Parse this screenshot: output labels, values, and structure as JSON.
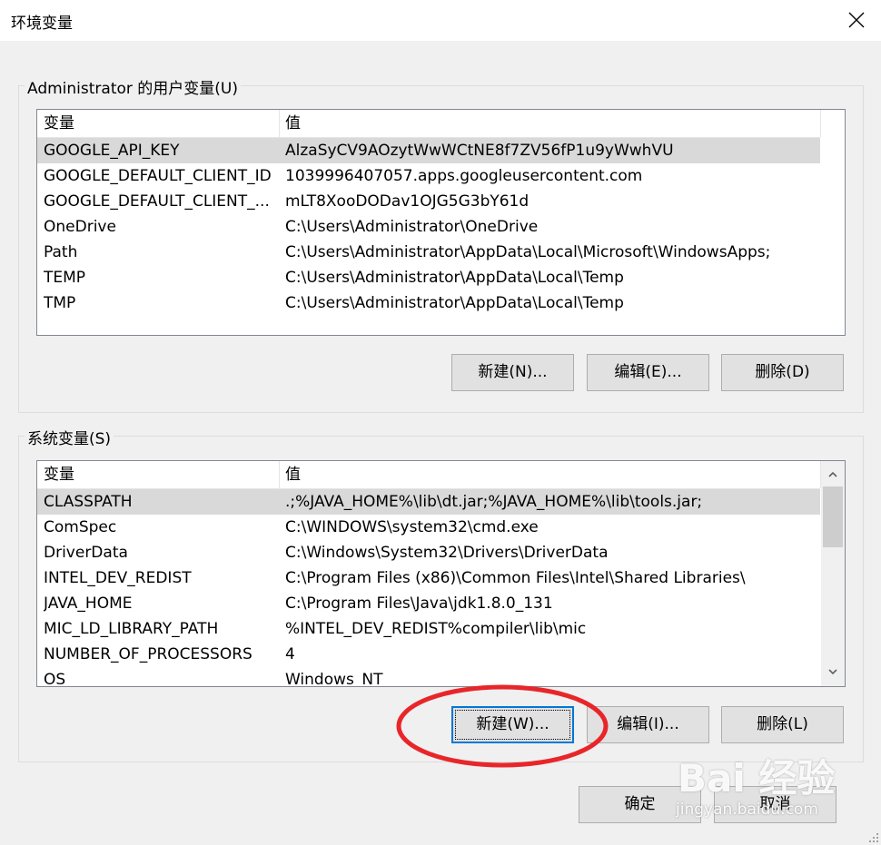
{
  "window": {
    "title": "环境变量"
  },
  "user_vars": {
    "legend": "Administrator 的用户变量(U)",
    "col_name": "变量",
    "col_value": "值",
    "rows": [
      {
        "name": "GOOGLE_API_KEY",
        "value": "AlzaSyCV9AOzytWwWCtNE8f7ZV56fP1u9yWwhVU",
        "selected": true
      },
      {
        "name": "GOOGLE_DEFAULT_CLIENT_ID",
        "value": "1039996407057.apps.googleusercontent.com"
      },
      {
        "name": "GOOGLE_DEFAULT_CLIENT_...",
        "value": "mLT8XooDODav1OJG5G3bY61d"
      },
      {
        "name": "OneDrive",
        "value": "C:\\Users\\Administrator\\OneDrive"
      },
      {
        "name": "Path",
        "value": "C:\\Users\\Administrator\\AppData\\Local\\Microsoft\\WindowsApps;"
      },
      {
        "name": "TEMP",
        "value": "C:\\Users\\Administrator\\AppData\\Local\\Temp"
      },
      {
        "name": "TMP",
        "value": "C:\\Users\\Administrator\\AppData\\Local\\Temp"
      }
    ],
    "buttons": {
      "new": "新建(N)...",
      "edit": "编辑(E)...",
      "delete": "删除(D)"
    }
  },
  "system_vars": {
    "legend": "系统变量(S)",
    "col_name": "变量",
    "col_value": "值",
    "rows": [
      {
        "name": "CLASSPATH",
        "value": ".;%JAVA_HOME%\\lib\\dt.jar;%JAVA_HOME%\\lib\\tools.jar;",
        "selected": true
      },
      {
        "name": "ComSpec",
        "value": "C:\\WINDOWS\\system32\\cmd.exe"
      },
      {
        "name": "DriverData",
        "value": "C:\\Windows\\System32\\Drivers\\DriverData"
      },
      {
        "name": "INTEL_DEV_REDIST",
        "value": "C:\\Program Files (x86)\\Common Files\\Intel\\Shared Libraries\\"
      },
      {
        "name": "JAVA_HOME",
        "value": "C:\\Program Files\\Java\\jdk1.8.0_131"
      },
      {
        "name": "MIC_LD_LIBRARY_PATH",
        "value": "%INTEL_DEV_REDIST%compiler\\lib\\mic"
      },
      {
        "name": "NUMBER_OF_PROCESSORS",
        "value": "4"
      },
      {
        "name": "OS",
        "value": "Windows_NT"
      }
    ],
    "buttons": {
      "new": "新建(W)...",
      "edit": "编辑(I)...",
      "delete": "删除(L)"
    }
  },
  "dialog_buttons": {
    "ok": "确定",
    "cancel": "取消"
  },
  "watermark": {
    "logo": "Bai 经验",
    "site": "jingyan.baidu.com"
  },
  "colors": {
    "annotation": "#e8262a",
    "selection": "#d9d9d9",
    "focus": "#0078d7"
  },
  "icons": {
    "close": "close-icon",
    "scroll_up": "chevron-up-icon",
    "scroll_down": "chevron-down-icon"
  }
}
